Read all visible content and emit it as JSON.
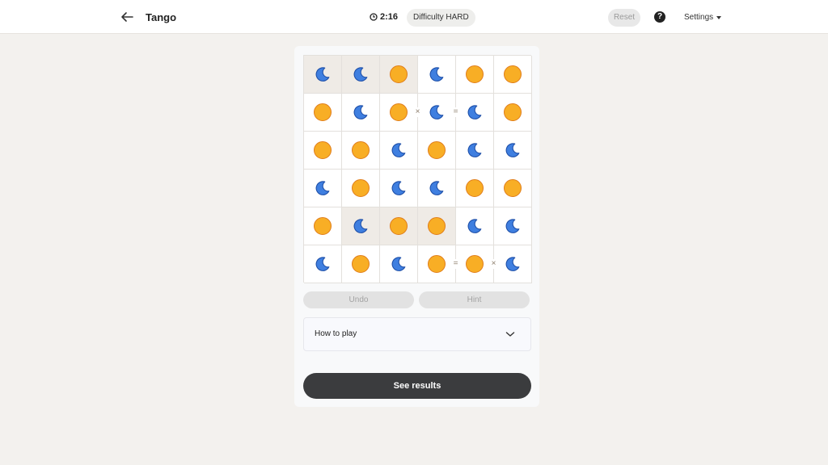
{
  "header": {
    "title": "Tango",
    "timer": "2:16",
    "difficulty": "Difficulty HARD",
    "reset_label": "Reset",
    "help_label": "?",
    "settings_label": "Settings"
  },
  "board": {
    "size": 6,
    "rows": [
      [
        "moon",
        "moon",
        "sun",
        "moon",
        "sun",
        "sun"
      ],
      [
        "sun",
        "moon",
        "sun",
        "moon",
        "moon",
        "sun"
      ],
      [
        "sun",
        "sun",
        "moon",
        "sun",
        "moon",
        "moon"
      ],
      [
        "moon",
        "sun",
        "moon",
        "moon",
        "sun",
        "sun"
      ],
      [
        "sun",
        "moon",
        "sun",
        "sun",
        "moon",
        "moon"
      ],
      [
        "moon",
        "sun",
        "moon",
        "sun",
        "sun",
        "moon"
      ]
    ],
    "locked": [
      [
        0,
        0
      ],
      [
        0,
        1
      ],
      [
        0,
        2
      ],
      [
        4,
        1
      ],
      [
        4,
        2
      ],
      [
        4,
        3
      ]
    ],
    "constraints": [
      {
        "row": 1,
        "col": 2,
        "symbol": "×"
      },
      {
        "row": 1,
        "col": 3,
        "symbol": "="
      },
      {
        "row": 5,
        "col": 3,
        "symbol": "="
      },
      {
        "row": 5,
        "col": 4,
        "symbol": "×"
      }
    ]
  },
  "controls": {
    "undo_label": "Undo",
    "hint_label": "Hint",
    "how_to_play_label": "How to play",
    "see_results_label": "See results"
  },
  "colors": {
    "sun_fill": "#f8ae25",
    "sun_stroke": "#e07d1a",
    "moon_fill": "#3f7fe0",
    "moon_stroke": "#1e4fa8",
    "locked_cell": "#efebe6",
    "results_button": "#3b3c3e"
  },
  "icons": {
    "back": "arrow-left-icon",
    "timer": "clock-icon",
    "help": "question-circle-icon",
    "settings": "caret-down-icon",
    "expand": "chevron-down-icon"
  }
}
